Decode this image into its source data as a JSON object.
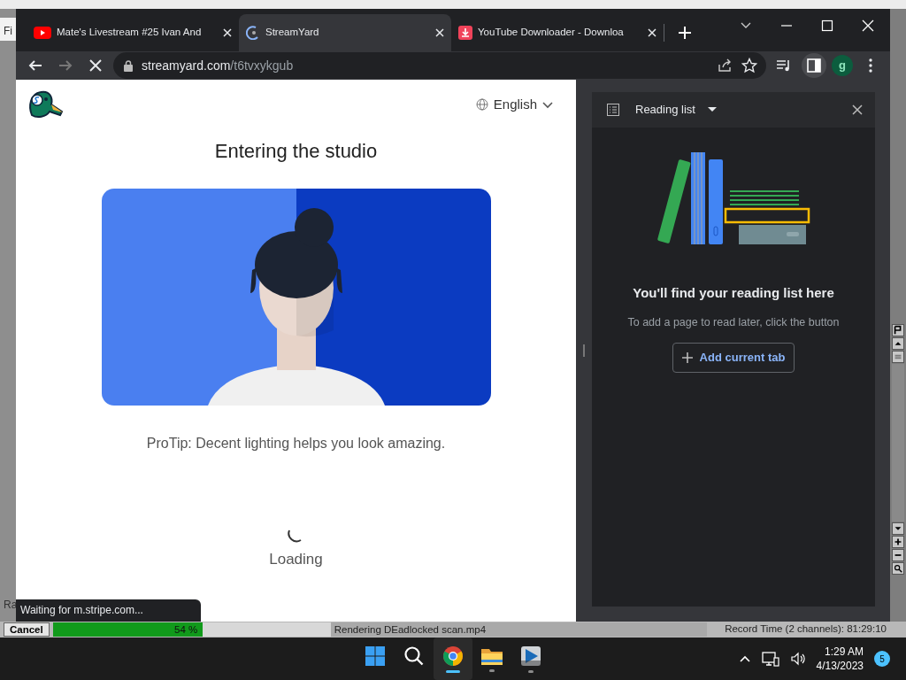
{
  "vegas_left": {
    "menu_fragment": "Fi",
    "label_fragment": "Ra"
  },
  "browser": {
    "tabs": [
      {
        "kind": "youtube",
        "title": "Mate's Livestream #25 Ivan And",
        "selected": false
      },
      {
        "kind": "streamyard",
        "title": "StreamYard",
        "selected": true
      },
      {
        "kind": "download",
        "title": "YouTube Downloader - Downloa",
        "selected": false
      }
    ],
    "address": {
      "domain": "streamyard.com",
      "path": "/t6tvxykgub"
    },
    "profile_initial": "g",
    "status_bubble": "Waiting for m.stripe.com..."
  },
  "page": {
    "language": "English",
    "heading": "Entering the studio",
    "protip": "ProTip: Decent lighting helps you look amazing.",
    "loading_text": "Loading"
  },
  "reading_list": {
    "title": "Reading list",
    "empty_title": "You'll find your reading list here",
    "empty_text": "To add a page to read later, click the button",
    "button": "Add current tab"
  },
  "vegas_status": {
    "cancel": "Cancel",
    "progress": {
      "level": 0.54,
      "reading": "54 %"
    },
    "render_status": "Rendering DEadlocked scan.mp4",
    "record_time": "Record Time (2 channels): 81:29:10"
  },
  "taskbar": {
    "apps": [
      {
        "kind": "start",
        "running": false,
        "selected": false
      },
      {
        "kind": "search",
        "running": false,
        "selected": false
      },
      {
        "kind": "chrome",
        "running": true,
        "selected": true
      },
      {
        "kind": "folder",
        "running": true,
        "selected": false
      },
      {
        "kind": "vegas",
        "running": true,
        "selected": false
      }
    ],
    "time": "1:29 AM",
    "date": "4/13/2023",
    "notifications": "5"
  }
}
